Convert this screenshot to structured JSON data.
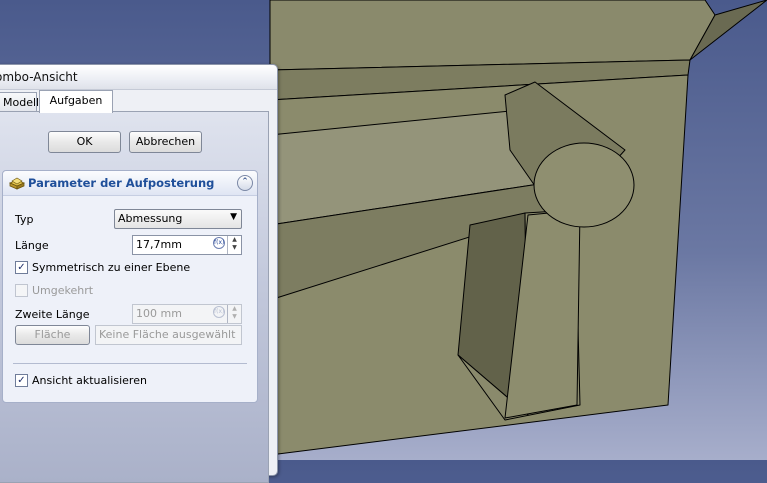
{
  "combo_view": {
    "title": "ombo-Ansicht",
    "tabs": [
      {
        "label": "Modell"
      },
      {
        "label": "Aufgaben"
      }
    ]
  },
  "dialog_buttons": {
    "ok_label": "OK",
    "cancel_label": "Abbrechen"
  },
  "taskbox": {
    "title": "Parameter der Aufposterung",
    "type_label": "Typ",
    "type_value": "Abmessung",
    "length_label": "Länge",
    "length_value": "17,7mm",
    "symmetric_label": "Symmetrisch zu einer Ebene",
    "symmetric_checked": true,
    "reversed_label": "Umgekehrt",
    "reversed_checked": false,
    "second_length_label": "Zweite Länge",
    "second_length_value": "100 mm",
    "face_button_label": "Fläche",
    "face_value": "Keine Fläche ausgewählt",
    "update_view_label": "Ansicht aktualisieren",
    "update_view_checked": true
  },
  "colors": {
    "model_face": "#8b8b6b",
    "model_dark": "#5f5f47",
    "background_top": "#4a5a8c",
    "header_text": "#1f4f9a"
  }
}
